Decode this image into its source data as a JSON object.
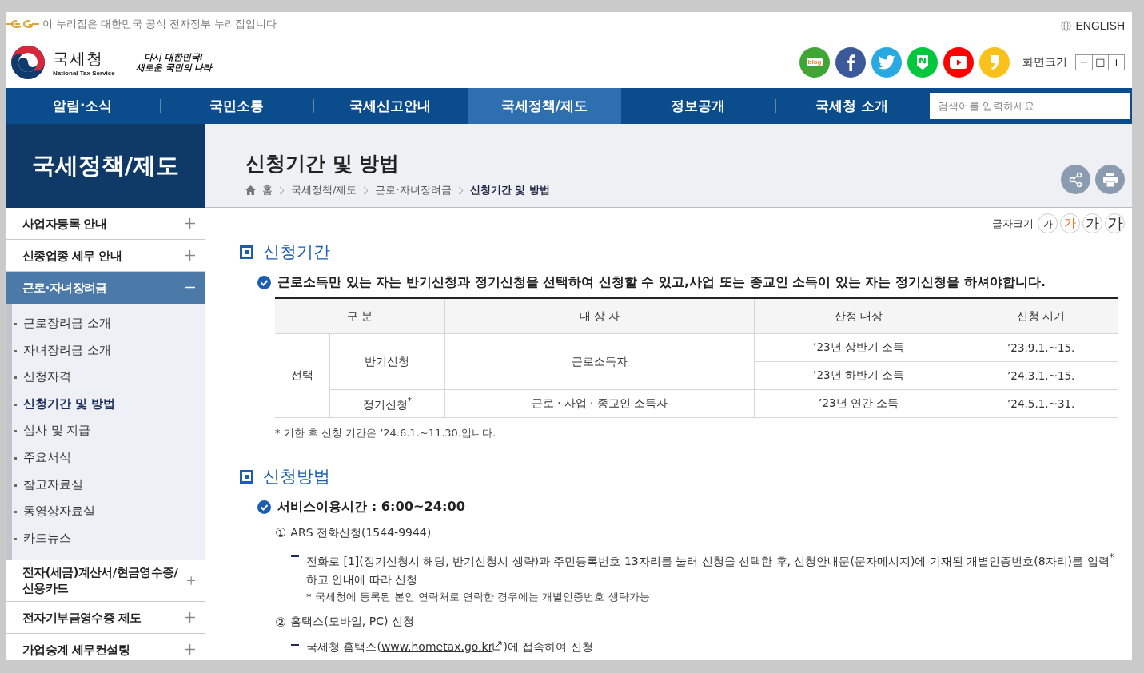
{
  "gov_banner": {
    "text": "이 누리집은 대한민국 공식 전자정부 누리집입니다"
  },
  "language_link": "ENGLISH",
  "logo": {
    "name": "국세청",
    "subtitle": "National Tax Service"
  },
  "slogan": [
    "다시 대한민국!",
    "새로운 국민의 나라"
  ],
  "social": [
    {
      "kind": "blog",
      "label": "blog"
    },
    {
      "kind": "facebook"
    },
    {
      "kind": "twitter"
    },
    {
      "kind": "naver"
    },
    {
      "kind": "youtube"
    },
    {
      "kind": "kakao"
    }
  ],
  "zoom": {
    "label": "화면크기",
    "buttons": [
      "−",
      "□",
      "+"
    ]
  },
  "nav": [
    {
      "label": "알림·소식",
      "selected": false
    },
    {
      "label": "국민소통",
      "selected": false
    },
    {
      "label": "국세신고안내",
      "selected": false
    },
    {
      "label": "국세정책/제도",
      "selected": true
    },
    {
      "label": "정보공개",
      "selected": false
    },
    {
      "label": "국세청 소개",
      "selected": false
    }
  ],
  "search": {
    "placeholder": "검색어를 입력하세요"
  },
  "sidebar": {
    "title": "국세정책/제도",
    "items": [
      {
        "label": "사업자등록 안내",
        "expanded": false
      },
      {
        "label": "신종업종 세무 안내",
        "expanded": false
      },
      {
        "label": "근로·자녀장려금",
        "expanded": true,
        "children": [
          {
            "label": "근로장려금 소개",
            "selected": false
          },
          {
            "label": "자녀장려금 소개",
            "selected": false
          },
          {
            "label": "신청자격",
            "selected": false
          },
          {
            "label": "신청기간 및 방법",
            "selected": true
          },
          {
            "label": "심사 및 지급",
            "selected": false
          },
          {
            "label": "주요서식",
            "selected": false
          },
          {
            "label": "참고자료실",
            "selected": false
          },
          {
            "label": "동영상자료실",
            "selected": false
          },
          {
            "label": "카드뉴스",
            "selected": false
          }
        ]
      },
      {
        "label": "전자(세금)계산서/현금영수증/신용카드",
        "expanded": false
      },
      {
        "label": "전자기부금영수증 제도",
        "expanded": false
      },
      {
        "label": "가업승계 세무컨설팅",
        "expanded": false
      }
    ]
  },
  "page_title": "신청기간 및 방법",
  "breadcrumb": [
    "홈",
    "국세정책/제도",
    "근로·자녀장려금",
    "신청기간 및 방법"
  ],
  "font_size": {
    "label": "글자크기",
    "options": [
      {
        "label": "가",
        "selected": false
      },
      {
        "label": "가",
        "selected": true
      },
      {
        "label": "가",
        "selected": false
      },
      {
        "label": "가",
        "selected": false
      }
    ]
  },
  "section_period": {
    "heading": "신청기간",
    "lead": "근로소득만 있는 자는 반기신청과 정기신청을 선택하여 신청할 수 있고,사업 또는 종교인 소득이 있는 자는 정기신청을 하셔야합니다.",
    "table": {
      "columns": [
        "구 분",
        "대 상 자",
        "산정 대상",
        "신청 시기"
      ],
      "groups": [
        {
          "label": "선택",
          "types": [
            {
              "label": "반기신청",
              "target": "근로소득자",
              "periods": [
                {
                  "basis": "’23년 상반기 소득",
                  "period": "’23.9.1.~15."
                },
                {
                  "basis": "’23년 하반기 소득",
                  "period": "’24.3.1.~15."
                }
              ]
            },
            {
              "label": "정기신청$^{*}$",
              "target": "근로 · 사업 · 종교인 소득자",
              "periods": [
                {
                  "basis": "’23년 연간 소득",
                  "period": "’24.5.1.~31."
                }
              ]
            }
          ]
        }
      ]
    },
    "footnote": "* 기한 후 신청 기간은 ’24.6.1.~11.30.입니다."
  },
  "section_method": {
    "heading": "신청방법",
    "lead": "서비스이용시간 : 6:00~24:00",
    "methods": [
      {
        "number": "①",
        "title": "ARS 전화신청(1544-9944)",
        "steps": [
          {
            "kind": "text",
            "text": "전화로 [1](정기신청시 해당, 반기신청시 생략)과 주민등록번호 13자리를 눌러 신청을 선택한 후, 신청안내문(문자메시지)에 기재된 개별인증번호(8자리)를 입력$^{*}$ 하고 안내에 따라 신청",
            "note": "* 국세청에 등록된 본인 연락처로 연락한 경우에는 개별인증번호 생략가능"
          }
        ]
      },
      {
        "number": "②",
        "title": "홈택스(모바일, PC) 신청",
        "steps": [
          {
            "kind": "link",
            "before": "국세청 홈택스(",
            "link": "www.hometax.go.kr",
            "after": ")에 접속하여 신청"
          }
        ]
      }
    ]
  }
}
